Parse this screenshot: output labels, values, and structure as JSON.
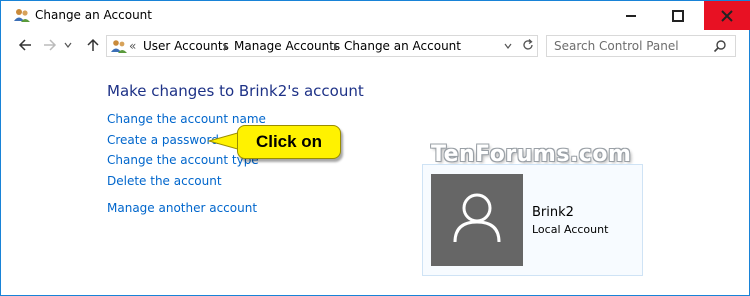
{
  "window": {
    "title": "Change an Account"
  },
  "address_bar": {
    "prefix": "«",
    "breadcrumbs": [
      "User Accounts",
      "Manage Accounts",
      "Change an Account"
    ]
  },
  "search": {
    "placeholder": "Search Control Panel"
  },
  "main": {
    "heading": "Make changes to Brink2's account",
    "links": {
      "change_name": "Change the account name",
      "create_password": "Create a password",
      "change_type": "Change the account type",
      "delete": "Delete the account",
      "manage_another": "Manage another account"
    }
  },
  "callout": {
    "text": "Click on",
    "color": "#fff200"
  },
  "watermark": "TenForums.com",
  "account": {
    "name": "Brink2",
    "type": "Local Account"
  },
  "colors": {
    "link": "#0066cc",
    "heading": "#1e3287",
    "close_button": "#e81123",
    "avatar_bg": "#666666"
  }
}
